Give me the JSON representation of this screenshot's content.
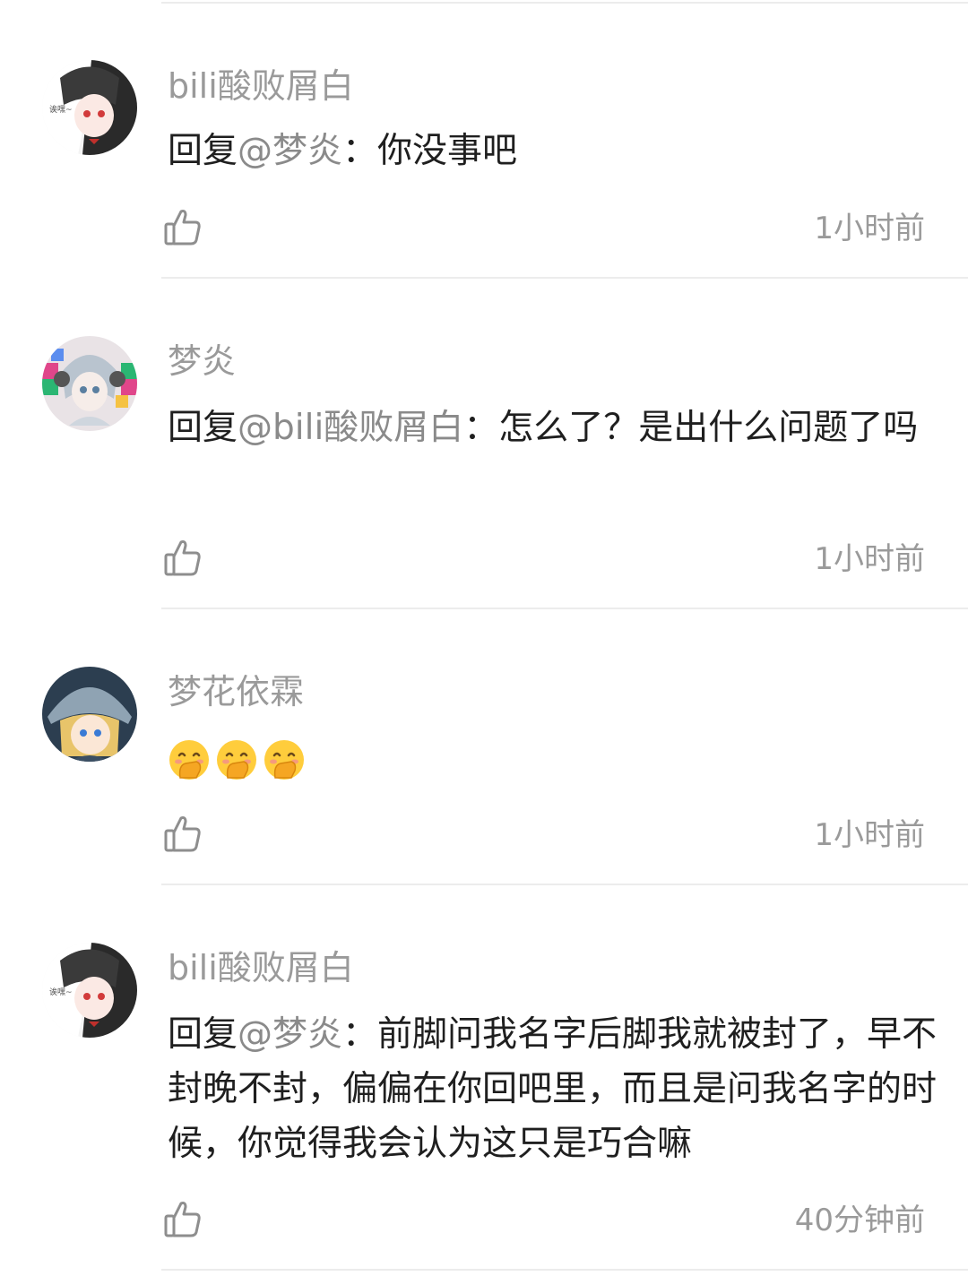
{
  "comments": [
    {
      "username": "bili酸败屑白",
      "reply_prefix": "回复",
      "mention": "@梦炎",
      "separator": "：",
      "text": "你没事吧",
      "time": "1小时前",
      "avatar_icon": "anime-maid-avatar-icon"
    },
    {
      "username": "梦炎",
      "reply_prefix": "回复",
      "mention": "@bili酸败屑白",
      "separator": "：",
      "text": "怎么了？是出什么问题了吗",
      "time": "1小时前",
      "avatar_icon": "anime-headphones-avatar-icon"
    },
    {
      "username": "梦花依霖",
      "emojis": [
        "hand-over-mouth-emoji",
        "hand-over-mouth-emoji",
        "hand-over-mouth-emoji"
      ],
      "time": "1小时前",
      "avatar_icon": "anime-helmet-avatar-icon"
    },
    {
      "username": "bili酸败屑白",
      "reply_prefix": "回复",
      "mention": "@梦炎",
      "separator": "：",
      "text": "前脚问我名字后脚我就被封了，早不封晚不封，偏偏在你回吧里，而且是问我名字的时候，你觉得我会认为这只是巧合嘛",
      "time": "40分钟前",
      "avatar_icon": "anime-maid-avatar-icon"
    }
  ],
  "icons": {
    "like": "thumbs-up-icon"
  },
  "colors": {
    "text": "#1f1f1f",
    "secondary": "#9a9a9a",
    "divider": "#ececec"
  }
}
